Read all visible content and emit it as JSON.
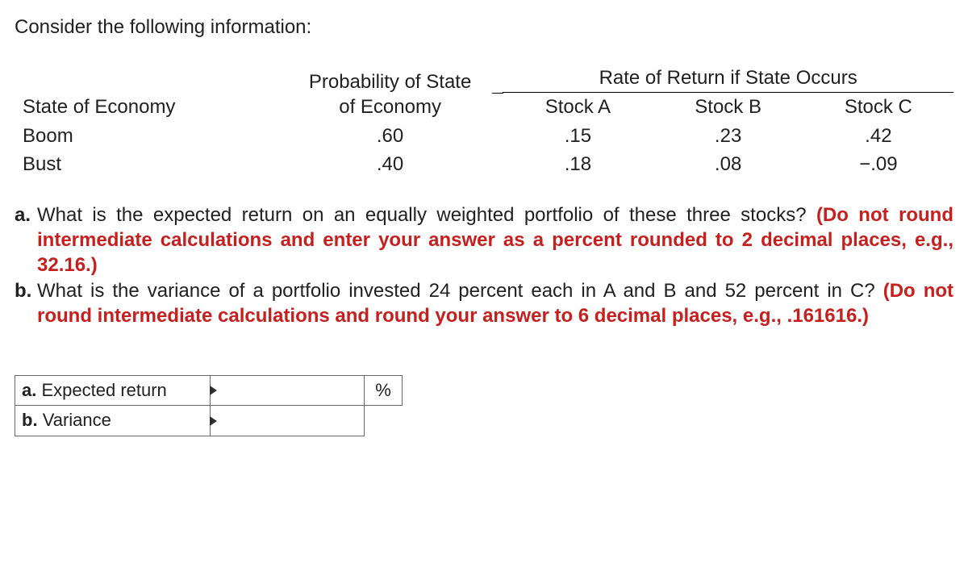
{
  "intro": "Consider the following information:",
  "table": {
    "rate_header": "Rate of Return if State Occurs",
    "headers": {
      "state": "State of Economy",
      "prob_line1": "Probability of State",
      "prob_line2": "of Economy",
      "stockA": "Stock A",
      "stockB": "Stock B",
      "stockC": "Stock C"
    },
    "rows": [
      {
        "state": "Boom",
        "prob": ".60",
        "a": ".15",
        "b": ".23",
        "c": ".42"
      },
      {
        "state": "Bust",
        "prob": ".40",
        "a": ".18",
        "b": ".08",
        "c": "−.09"
      }
    ]
  },
  "questions": {
    "a": {
      "marker": "a.",
      "text": "What is the expected return on an equally weighted portfolio of these three stocks? ",
      "hint": "(Do not round intermediate calculations and enter your answer as a percent rounded to 2 decimal places, e.g., 32.16.)"
    },
    "b": {
      "marker": "b.",
      "text": "What is the variance of a portfolio invested 24 percent each in A and B and 52 percent in C? ",
      "hint": "(Do not round intermediate calculations and round your answer to 6 decimal places, e.g., .161616.)"
    }
  },
  "answers": {
    "a_marker": "a.",
    "a_label": "Expected return",
    "a_unit": "%",
    "b_marker": "b.",
    "b_label": "Variance"
  }
}
